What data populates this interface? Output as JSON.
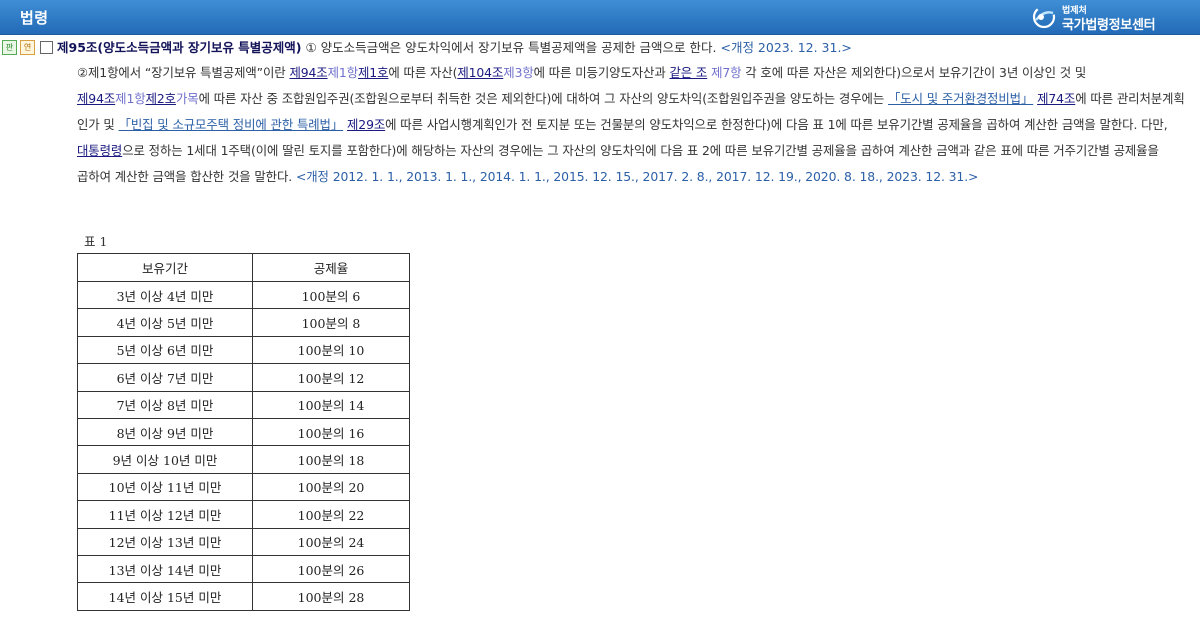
{
  "header": {
    "title": "법령",
    "logo_small": "법제처",
    "logo_big": "국가법령정보센터"
  },
  "article": {
    "badge_pan": "판",
    "badge_yeon": "연",
    "title": "제95조(양도소득금액과 장기보유 특별공제액)",
    "clause1": " ① 양도소득금액은 양도차익에서 장기보유 특별공제액을 공제한 금액으로 한다. ",
    "clause1_amend": "<개정 2023. 12. 31.>"
  },
  "paragraph2": {
    "t01": "②제1항에서 “장기보유 특별공제액”이란 ",
    "l01": "제94조",
    "l02": "제1항",
    "l03": "제1호",
    "t02": "에 따른 자산(",
    "l04": "제104조",
    "l05": "제3항",
    "t03": "에 따른 미등기양도자산과 ",
    "l06": "같은 조",
    "t04": " ",
    "l07": "제7항",
    "t05": " 각 호에 따른 자산은 제외한다)으로서 보유기간이 3년 이상인 것 및 ",
    "l08": "제94조",
    "l09": "제1항",
    "l10": "제2호",
    "l11": "가목",
    "t06": "에 따른 자산 중 조합원입주권(조합원으로부터 취득한 것은 제외한다)에 대하여 그 자산의 양도차익(조합원입주권을 양도하는 경우에는 ",
    "l12": "「도시 및 주거환경정비법」",
    "t07": " ",
    "l13": "제74조",
    "t08": "에 따른 관리처분계획 인가 및 ",
    "l14": "「빈집 및 소규모주택 정비에 관한 특례법」",
    "t09": " ",
    "l15": "제29조",
    "t10": "에 따른 사업시행계획인가 전 토지분 또는 건물분의 양도차익으로 한정한다)에 다음 표 1에 따른 보유기간별 공제율을 곱하여 계산한 금액을 말한다. 다만, ",
    "l16": "대통령령",
    "t11": "으로 정하는 1세대 1주택(이에 딸린 토지를 포함한다)에 해당하는 자산의 경우에는 그 자산의 양도차익에 다음 표 2에 따른 보유기간별 공제율을 곱하여 계산한 금액과 같은 표에 따른 거주기간별 공제율을 곱하여 계산한 금액을 합산한 것을 말한다.  ",
    "amend": "<개정 2012. 1. 1., 2013. 1. 1., 2014. 1. 1., 2015. 12. 15., 2017. 2. 8., 2017. 12. 19., 2020. 8. 18., 2023. 12. 31.>"
  },
  "table1": {
    "caption": "표 1",
    "headers": [
      "보유기간",
      "공제율"
    ],
    "rows": [
      [
        "3년 이상 4년 미만",
        "100분의 6"
      ],
      [
        "4년 이상 5년 미만",
        "100분의 8"
      ],
      [
        "5년 이상 6년 미만",
        "100분의 10"
      ],
      [
        "6년 이상 7년 미만",
        "100분의 12"
      ],
      [
        "7년 이상 8년 미만",
        "100분의 14"
      ],
      [
        "8년 이상 9년 미만",
        "100분의 16"
      ],
      [
        "9년 이상 10년 미만",
        "100분의 18"
      ],
      [
        "10년 이상 11년 미만",
        "100분의 20"
      ],
      [
        "11년 이상 12년 미만",
        "100분의 22"
      ],
      [
        "12년 이상 13년 미만",
        "100분의 24"
      ],
      [
        "13년 이상 14년 미만",
        "100분의 26"
      ],
      [
        "14년 이상 15년 미만",
        "100분의 28"
      ]
    ]
  }
}
